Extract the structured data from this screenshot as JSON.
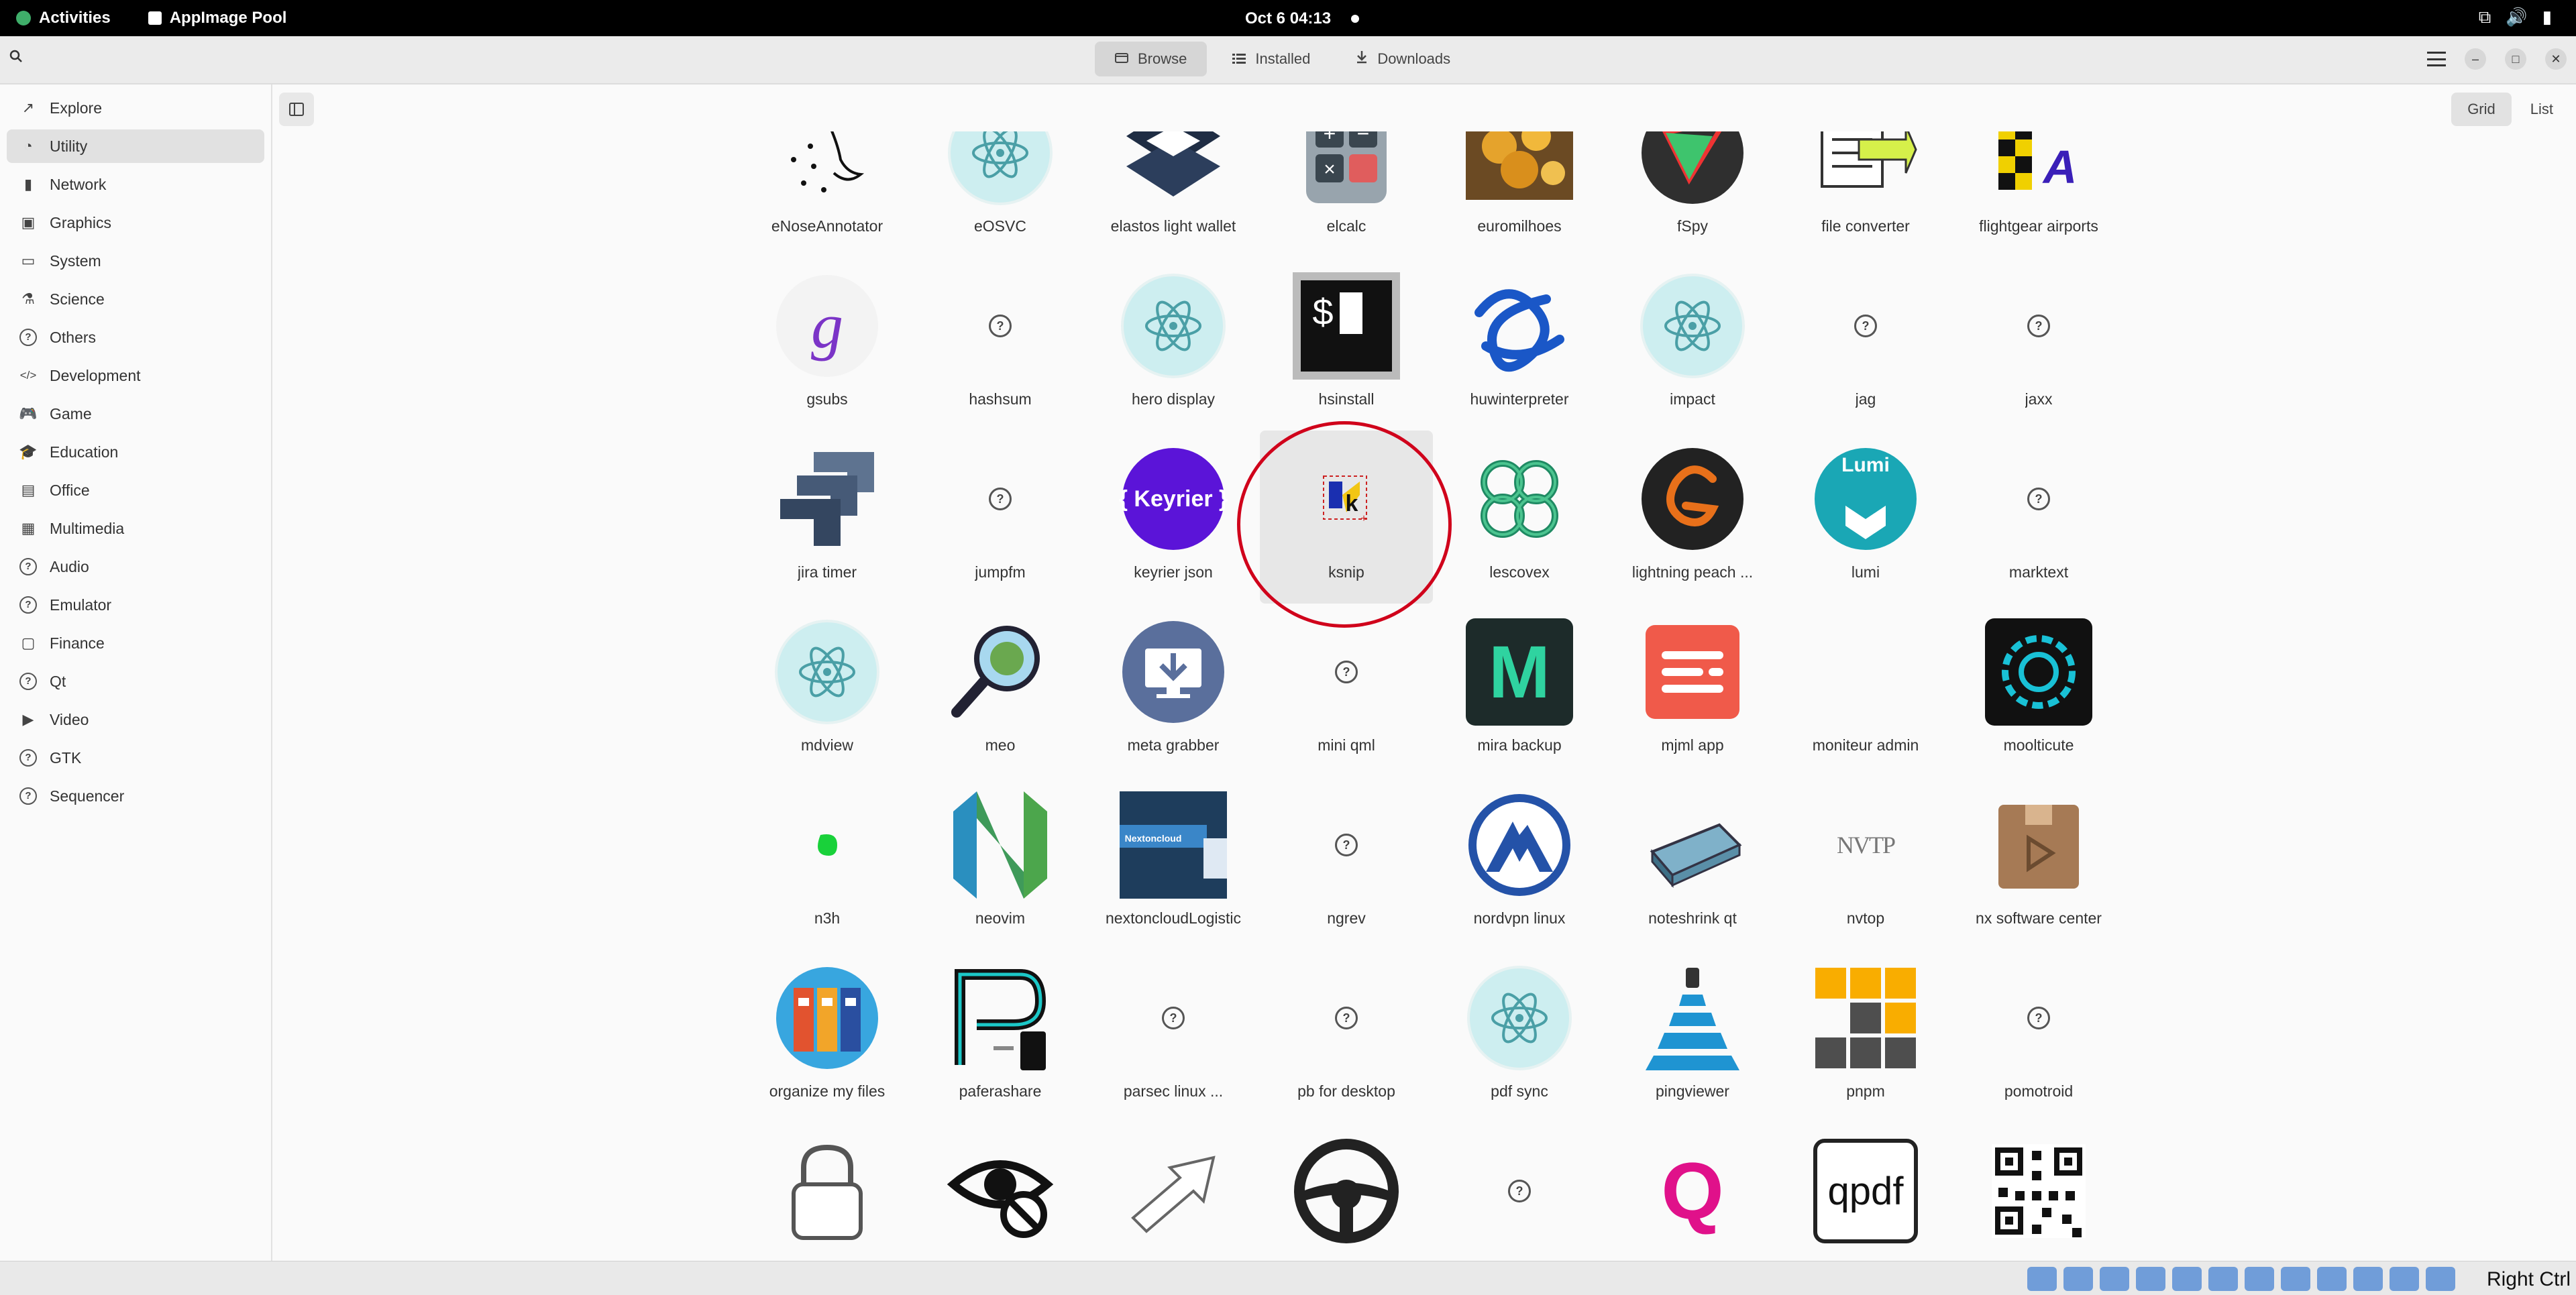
{
  "topbar": {
    "activities": "Activities",
    "app_name": "AppImage Pool",
    "clock": "Oct 6  04:13"
  },
  "header": {
    "tabs": [
      {
        "label": "Browse",
        "icon": "browse-icon",
        "active": true
      },
      {
        "label": "Installed",
        "icon": "list-icon",
        "active": false
      },
      {
        "label": "Downloads",
        "icon": "download-icon",
        "active": false
      }
    ]
  },
  "sidebar": {
    "items": [
      {
        "label": "Explore",
        "icon": "trend-icon",
        "active": false
      },
      {
        "label": "Utility",
        "icon": "gauge-icon",
        "active": true
      },
      {
        "label": "Network",
        "icon": "bars-icon",
        "active": false
      },
      {
        "label": "Graphics",
        "icon": "image-icon",
        "active": false
      },
      {
        "label": "System",
        "icon": "monitor-icon",
        "active": false
      },
      {
        "label": "Science",
        "icon": "flask-icon",
        "active": false
      },
      {
        "label": "Others",
        "icon": "question-icon",
        "active": false
      },
      {
        "label": "Development",
        "icon": "code-icon",
        "active": false
      },
      {
        "label": "Game",
        "icon": "gamepad-icon",
        "active": false
      },
      {
        "label": "Education",
        "icon": "graduation-icon",
        "active": false
      },
      {
        "label": "Office",
        "icon": "document-icon",
        "active": false
      },
      {
        "label": "Multimedia",
        "icon": "film-icon",
        "active": false
      },
      {
        "label": "Audio",
        "icon": "question-icon",
        "active": false
      },
      {
        "label": "Emulator",
        "icon": "question-icon",
        "active": false
      },
      {
        "label": "Finance",
        "icon": "finance-icon",
        "active": false
      },
      {
        "label": "Qt",
        "icon": "question-icon",
        "active": false
      },
      {
        "label": "Video",
        "icon": "video-icon",
        "active": false
      },
      {
        "label": "GTK",
        "icon": "question-icon",
        "active": false
      },
      {
        "label": "Sequencer",
        "icon": "question-icon",
        "active": false
      }
    ]
  },
  "view_toggle": {
    "grid": "Grid",
    "list": "List"
  },
  "apps": [
    {
      "name": "eNoseAnnotator",
      "icon": "nose-sketch-icon"
    },
    {
      "name": "eOSVC",
      "icon": "electron-icon"
    },
    {
      "name": "elastos light wallet",
      "icon": "layers-icon"
    },
    {
      "name": "elcalc",
      "icon": "calculator-icon"
    },
    {
      "name": "euromilhoes",
      "icon": "coins-photo-icon"
    },
    {
      "name": "fSpy",
      "icon": "fspy-icon"
    },
    {
      "name": "file converter",
      "icon": "file-convert-icon"
    },
    {
      "name": "flightgear airports",
      "icon": "checker-flag-icon"
    },
    {
      "name": "gsubs",
      "icon": "gsubs-icon"
    },
    {
      "name": "hashsum",
      "icon": "question-icon"
    },
    {
      "name": "hero display",
      "icon": "electron-icon"
    },
    {
      "name": "hsinstall",
      "icon": "terminal-icon"
    },
    {
      "name": "huwinterpreter",
      "icon": "knot-icon"
    },
    {
      "name": "impact",
      "icon": "electron-icon"
    },
    {
      "name": "jag",
      "icon": "question-icon"
    },
    {
      "name": "jaxx",
      "icon": "question-icon"
    },
    {
      "name": "jira timer",
      "icon": "jira-icon"
    },
    {
      "name": "jumpfm",
      "icon": "question-icon"
    },
    {
      "name": "keyrier json",
      "icon": "keyrier-icon",
      "badge": "{ Keyrier }"
    },
    {
      "name": "ksnip",
      "icon": "ksnip-icon",
      "selected": true
    },
    {
      "name": "lescovex",
      "icon": "lescovex-icon"
    },
    {
      "name": "lightning peach ...",
      "icon": "lightning-peach-icon"
    },
    {
      "name": "lumi",
      "icon": "lumi-icon",
      "badge": "Lumi"
    },
    {
      "name": "marktext",
      "icon": "question-icon"
    },
    {
      "name": "mdview",
      "icon": "electron-icon"
    },
    {
      "name": "meo",
      "icon": "magnifier-icon"
    },
    {
      "name": "meta grabber",
      "icon": "meta-grabber-icon"
    },
    {
      "name": "mini qml",
      "icon": "question-icon"
    },
    {
      "name": "mira backup",
      "icon": "mira-icon",
      "badge": "M"
    },
    {
      "name": "mjml app",
      "icon": "mjml-icon"
    },
    {
      "name": "moniteur admin",
      "icon": "blank-icon"
    },
    {
      "name": "moolticute",
      "icon": "moolticute-icon"
    },
    {
      "name": "n3h",
      "icon": "green-blob-icon"
    },
    {
      "name": "neovim",
      "icon": "neovim-icon"
    },
    {
      "name": "nextoncloudLogistic",
      "icon": "nextoncloud-icon",
      "badge": "Nextoncloud"
    },
    {
      "name": "ngrev",
      "icon": "question-icon"
    },
    {
      "name": "nordvpn linux",
      "icon": "nordvpn-icon"
    },
    {
      "name": "noteshrink qt",
      "icon": "scanner-icon"
    },
    {
      "name": "nvtop",
      "icon": "nvtop-icon",
      "badge": "NVTP"
    },
    {
      "name": "nx software center",
      "icon": "package-icon"
    },
    {
      "name": "organize my files",
      "icon": "binders-icon"
    },
    {
      "name": "paferashare",
      "icon": "paferashare-icon"
    },
    {
      "name": "parsec linux ...",
      "icon": "question-icon"
    },
    {
      "name": "pb for desktop",
      "icon": "question-icon"
    },
    {
      "name": "pdf sync",
      "icon": "electron-icon"
    },
    {
      "name": "pingviewer",
      "icon": "ping-icon"
    },
    {
      "name": "pnpm",
      "icon": "pnpm-icon"
    },
    {
      "name": "pomotroid",
      "icon": "question-icon"
    },
    {
      "name": "",
      "icon": "lock-icon"
    },
    {
      "name": "",
      "icon": "eye-block-icon"
    },
    {
      "name": "",
      "icon": "arrow-icon"
    },
    {
      "name": "",
      "icon": "steering-wheel-icon"
    },
    {
      "name": "",
      "icon": "question-icon"
    },
    {
      "name": "",
      "icon": "q-icon",
      "badge": "Q"
    },
    {
      "name": "",
      "icon": "qpdf-icon",
      "badge": "qpdf"
    },
    {
      "name": "",
      "icon": "qr-icon"
    }
  ],
  "taskbar": {
    "right_ctrl": "Right Ctrl"
  },
  "colors": {
    "highlight": "#d0021b",
    "sidebar_active": "#e1e1e1"
  }
}
